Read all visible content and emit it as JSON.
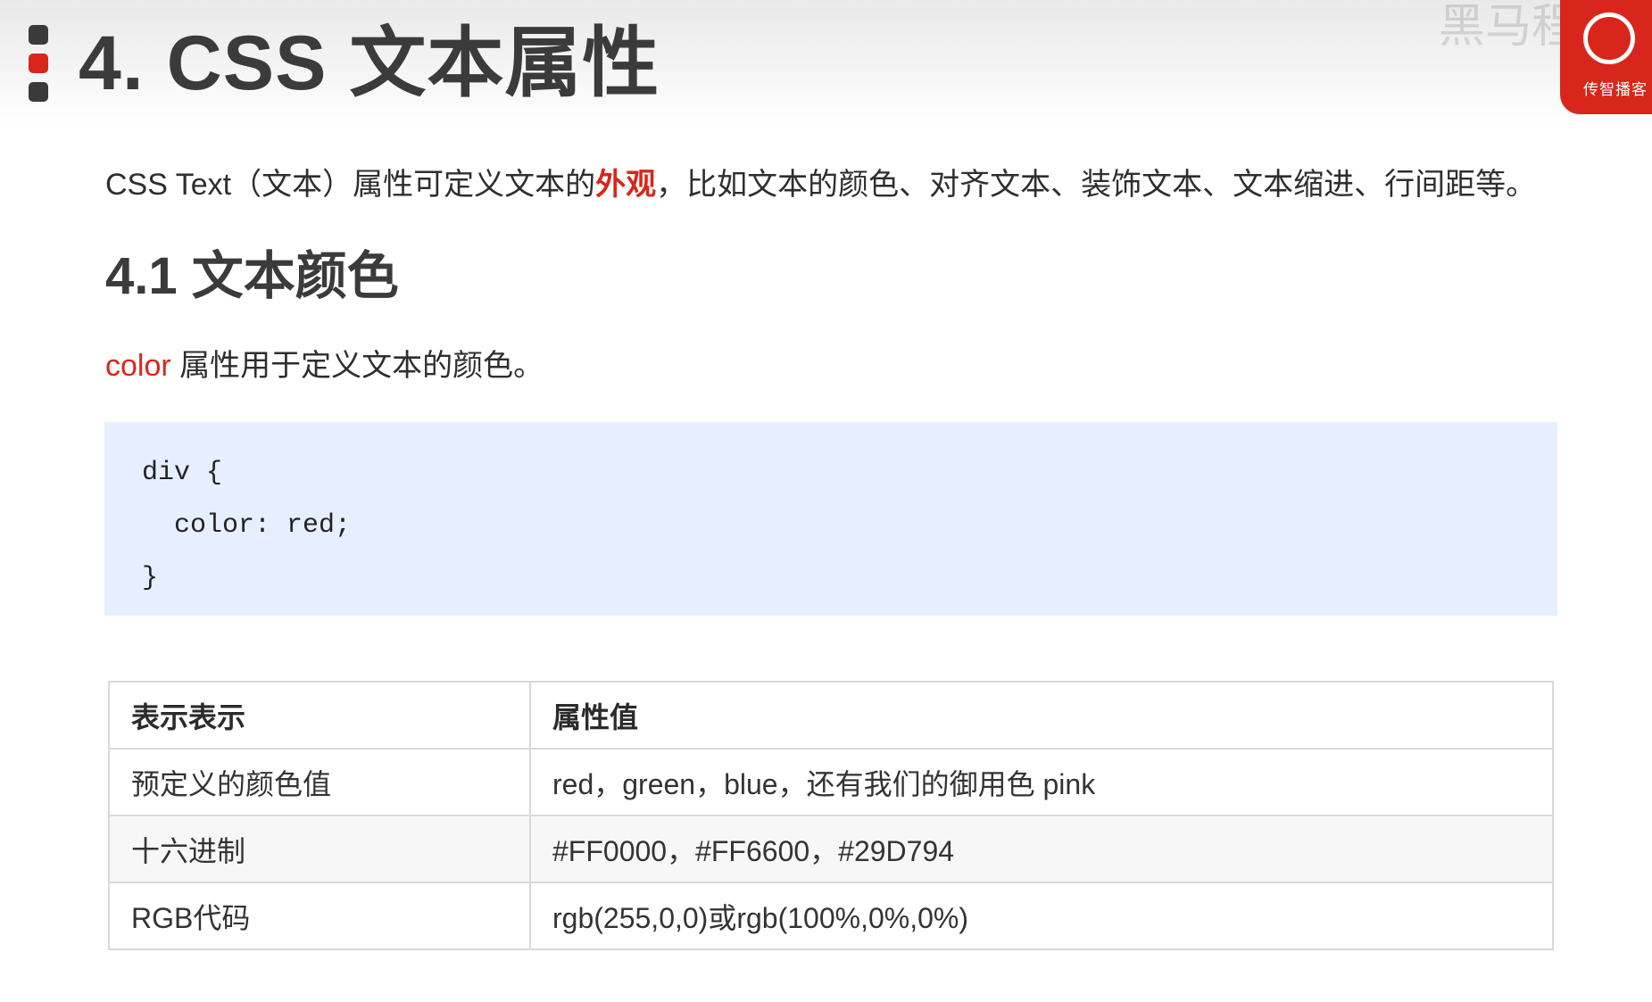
{
  "header": {
    "title": "4. CSS 文本属性",
    "watermark": "黑马程序员",
    "brand": "传智播客",
    "colors": {
      "accent": "#d9261c",
      "marker_dark": "#3a3a3a"
    }
  },
  "intro": {
    "before": "CSS Text（文本）属性可定义文本的",
    "highlight": "外观",
    "after": "，比如文本的颜色、对齐文本、装饰文本、文本缩进、行间距等。"
  },
  "section": {
    "title": "4.1 文本颜色",
    "desc_keyword": "color",
    "desc_text": " 属性用于定义文本的颜色。"
  },
  "code": {
    "lines": [
      "div {",
      "  color: red;",
      "}"
    ]
  },
  "table": {
    "headers": [
      "表示表示",
      "属性值"
    ],
    "rows": [
      [
        "预定义的颜色值",
        "red，green，blue，还有我们的御用色 pink"
      ],
      [
        "十六进制",
        "#FF0000，#FF6600，#29D794"
      ],
      [
        "RGB代码",
        "rgb(255,0,0)或rgb(100%,0%,0%)"
      ]
    ]
  }
}
